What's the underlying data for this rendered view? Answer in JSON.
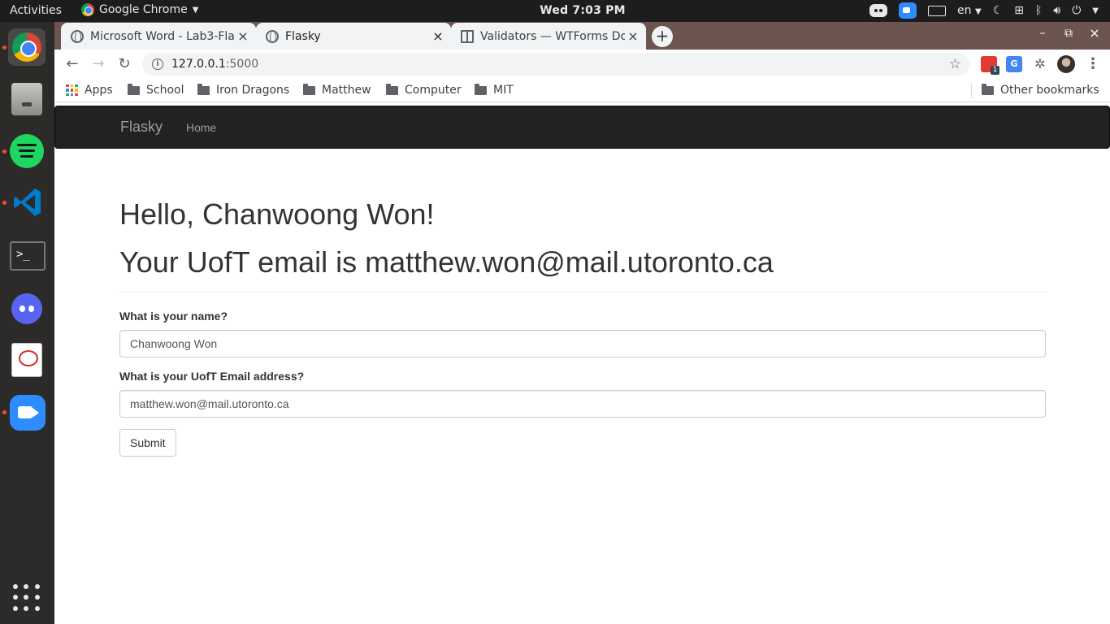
{
  "topbar": {
    "activities": "Activities",
    "app_name": "Google Chrome",
    "clock": "Wed  7:03 PM",
    "language": "en"
  },
  "dock": {
    "items": [
      "chrome-icon",
      "files-icon",
      "spotify-icon",
      "vscode-icon",
      "terminal-icon",
      "discord-icon",
      "document-viewer-icon",
      "zoom-icon"
    ],
    "terminal_glyph": ">_"
  },
  "tabs": [
    {
      "title": "Microsoft Word - Lab3-Fla",
      "icon": "globe-icon",
      "active": false
    },
    {
      "title": "Flasky",
      "icon": "globe-icon",
      "active": true
    },
    {
      "title": "Validators — WTForms Do",
      "icon": "book-icon",
      "active": false
    }
  ],
  "window_controls": {
    "minimize": "–",
    "maximize": "⧉",
    "close": "×"
  },
  "address": {
    "host": "127.0.0.1",
    "port": ":5000"
  },
  "bookmarks": {
    "items": [
      "Apps",
      "School",
      "Iron Dragons",
      "Matthew",
      "Computer",
      "MIT"
    ],
    "other": "Other bookmarks"
  },
  "page": {
    "brand": "Flasky",
    "nav_home": "Home",
    "greeting": "Hello, Chanwoong Won!",
    "email_line": "Your UofT email is matthew.won@mail.utoronto.ca",
    "form": {
      "name_label": "What is your name?",
      "name_value": "Chanwoong Won",
      "email_label": "What is your UofT Email address?",
      "email_value": "matthew.won@mail.utoronto.ca",
      "submit": "Submit"
    }
  },
  "colors": {
    "navbar": "#222222",
    "tabstrip": "#6c5450",
    "dock": "#2c2b29",
    "topbar": "#1d1d1d",
    "running_dot": "#e95420"
  }
}
